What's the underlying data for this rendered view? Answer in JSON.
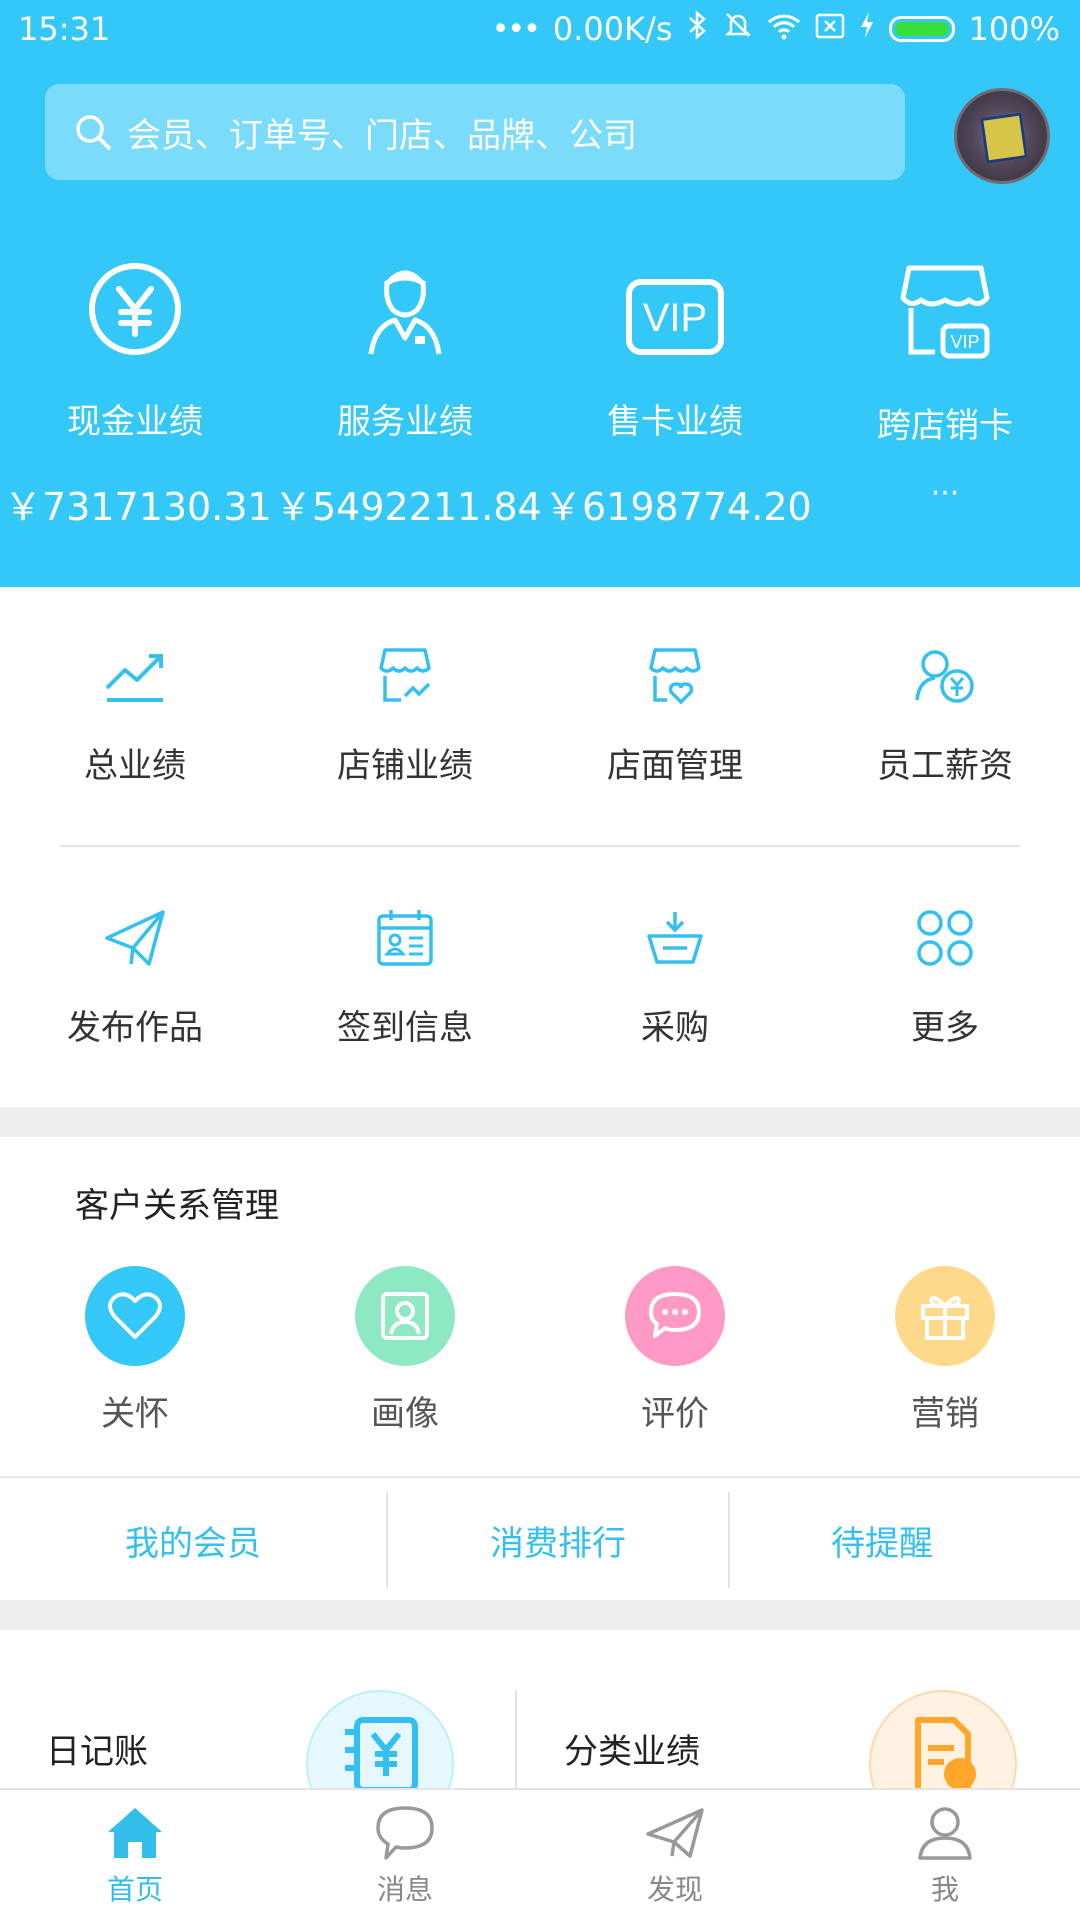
{
  "status_bar": {
    "time": "15:31",
    "network_speed": "0.00K/s",
    "battery": "100%"
  },
  "search": {
    "placeholder": "会员、订单号、门店、品牌、公司"
  },
  "stats": [
    {
      "label": "现金业绩",
      "value": "￥7317130.31",
      "icon": "yuan-circle-icon"
    },
    {
      "label": "服务业绩",
      "value": "￥5492211.84",
      "icon": "staff-icon"
    },
    {
      "label": "售卡业绩",
      "value": "￥6198774.20",
      "icon": "vip-card-icon"
    },
    {
      "label": "跨店销卡",
      "value": "···",
      "icon": "store-vip-icon"
    }
  ],
  "grid": {
    "row1": [
      {
        "label": "总业绩",
        "icon": "trend-chart-icon"
      },
      {
        "label": "店铺业绩",
        "icon": "store-chart-icon"
      },
      {
        "label": "店面管理",
        "icon": "store-heart-icon"
      },
      {
        "label": "员工薪资",
        "icon": "employee-salary-icon"
      }
    ],
    "row2": [
      {
        "label": "发布作品",
        "icon": "paper-plane-icon"
      },
      {
        "label": "签到信息",
        "icon": "calendar-card-icon"
      },
      {
        "label": "采购",
        "icon": "basket-icon"
      },
      {
        "label": "更多",
        "icon": "four-circles-icon"
      }
    ]
  },
  "crm": {
    "title": "客户关系管理",
    "items": [
      {
        "label": "关怀",
        "icon": "heart-icon",
        "color": "#33c8f7"
      },
      {
        "label": "画像",
        "icon": "portrait-icon",
        "color": "#8ee8c4"
      },
      {
        "label": "评价",
        "icon": "chat-bubble-icon",
        "color": "#ff9ac6"
      },
      {
        "label": "营销",
        "icon": "gift-icon",
        "color": "#ffd98a"
      }
    ],
    "tabs": [
      "我的会员",
      "消费排行",
      "待提醒"
    ]
  },
  "cards": [
    {
      "title": "日记账",
      "icon": "ledger-icon"
    },
    {
      "title": "分类业绩",
      "icon": "report-icon"
    }
  ],
  "bottom_nav": [
    {
      "label": "首页",
      "icon": "home-icon",
      "active": true
    },
    {
      "label": "消息",
      "icon": "message-icon",
      "active": false
    },
    {
      "label": "发现",
      "icon": "discover-plane-icon",
      "active": false
    },
    {
      "label": "我",
      "icon": "user-icon",
      "active": false
    }
  ],
  "colors": {
    "primary": "#33c8f7",
    "accent_text": "#33c0f0"
  }
}
